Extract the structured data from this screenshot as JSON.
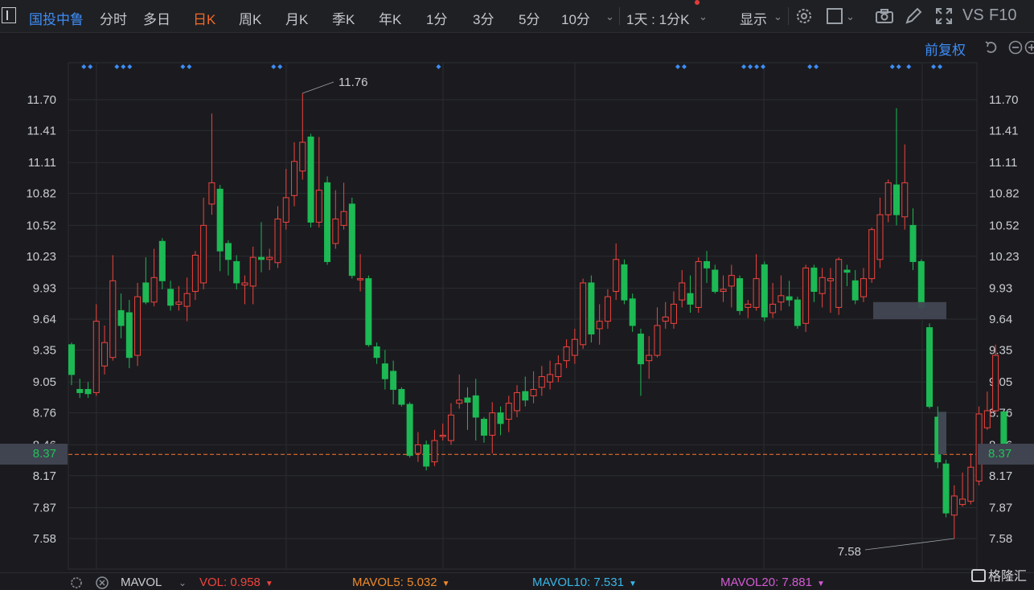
{
  "toolbar": {
    "symbol": "国投中鲁",
    "periods": [
      "分时",
      "多日",
      "日K",
      "周K",
      "月K",
      "季K",
      "年K",
      "1分",
      "3分",
      "5分",
      "10分"
    ],
    "active_period": "日K",
    "multi_period": "1天 : 1分K",
    "display": "显示",
    "vs_label": "VS",
    "f10_label": "F10"
  },
  "adjust_label": "前复权",
  "axis": {
    "price_ticks": [
      "11.70",
      "11.41",
      "11.11",
      "10.82",
      "10.52",
      "10.23",
      "9.93",
      "9.64",
      "9.35",
      "9.05",
      "8.76",
      "8.46",
      "8.17",
      "7.87",
      "7.58"
    ],
    "current_price": "8.37",
    "high_label": "11.76",
    "low_label": "7.58"
  },
  "chart_data": {
    "type": "candlestick",
    "ylim": [
      7.4,
      11.9
    ],
    "current_price": 8.37,
    "high": 11.76,
    "low": 7.58,
    "colors": {
      "up": "#f0433d",
      "down": "#1db954",
      "current_line": "#e46a2c",
      "background": "#1b1b1f",
      "grid": "#2a2c31",
      "marker": "#3d8df6"
    },
    "candles": [
      [
        9.4,
        9.12,
        9.42,
        9.02
      ],
      [
        8.98,
        8.95,
        9.08,
        8.9
      ],
      [
        8.98,
        8.94,
        9.05,
        8.9
      ],
      [
        8.95,
        9.62,
        9.78,
        8.92
      ],
      [
        9.2,
        9.42,
        9.58,
        9.12
      ],
      [
        9.28,
        10.0,
        10.24,
        9.25
      ],
      [
        9.72,
        9.58,
        9.88,
        9.46
      ],
      [
        9.7,
        9.28,
        9.82,
        9.18
      ],
      [
        9.3,
        9.85,
        9.98,
        9.2
      ],
      [
        9.98,
        9.8,
        10.22,
        9.78
      ],
      [
        9.8,
        10.03,
        10.3,
        9.76
      ],
      [
        10.37,
        10.0,
        10.4,
        9.92
      ],
      [
        9.92,
        9.77,
        10.0,
        9.72
      ],
      [
        9.78,
        9.8,
        9.95,
        9.72
      ],
      [
        9.76,
        9.88,
        10.03,
        9.62
      ],
      [
        9.9,
        10.24,
        10.28,
        9.82
      ],
      [
        9.98,
        10.52,
        10.78,
        9.92
      ],
      [
        10.72,
        10.92,
        11.57,
        10.62
      ],
      [
        10.86,
        10.28,
        10.9,
        10.09
      ],
      [
        10.35,
        10.2,
        10.38,
        10.05
      ],
      [
        10.18,
        9.98,
        10.24,
        9.92
      ],
      [
        9.96,
        9.98,
        10.05,
        9.78
      ],
      [
        9.95,
        10.22,
        10.32,
        9.78
      ],
      [
        10.22,
        10.2,
        10.55,
        10.08
      ],
      [
        10.2,
        10.22,
        10.3,
        10.1
      ],
      [
        10.17,
        10.58,
        10.7,
        10.12
      ],
      [
        10.55,
        10.78,
        11.05,
        10.48
      ],
      [
        10.8,
        11.12,
        11.3,
        10.7
      ],
      [
        11.03,
        11.3,
        11.76,
        10.95
      ],
      [
        11.35,
        10.55,
        11.38,
        10.5
      ],
      [
        10.55,
        10.85,
        11.35,
        10.5
      ],
      [
        10.92,
        10.18,
        10.98,
        10.15
      ],
      [
        10.35,
        10.58,
        10.85,
        10.3
      ],
      [
        10.52,
        10.65,
        10.92,
        10.48
      ],
      [
        10.72,
        10.05,
        10.78,
        10.02
      ],
      [
        10.02,
        10.02,
        10.25,
        9.9
      ],
      [
        10.02,
        9.4,
        10.05,
        9.38
      ],
      [
        9.38,
        9.28,
        9.42,
        9.22
      ],
      [
        9.22,
        9.08,
        9.35,
        8.98
      ],
      [
        9.15,
        8.98,
        9.25,
        8.84
      ],
      [
        8.98,
        8.84,
        9.0,
        8.82
      ],
      [
        8.84,
        8.36,
        8.86,
        8.34
      ],
      [
        8.38,
        8.46,
        8.58,
        8.3
      ],
      [
        8.46,
        8.26,
        8.5,
        8.22
      ],
      [
        8.3,
        8.5,
        8.6,
        8.26
      ],
      [
        8.54,
        8.55,
        8.66,
        8.5
      ],
      [
        8.5,
        8.74,
        8.85,
        8.46
      ],
      [
        8.85,
        8.88,
        9.12,
        8.8
      ],
      [
        8.9,
        8.86,
        9.0,
        8.6
      ],
      [
        8.92,
        8.72,
        9.08,
        8.5
      ],
      [
        8.7,
        8.55,
        8.72,
        8.48
      ],
      [
        8.55,
        8.76,
        8.86,
        8.38
      ],
      [
        8.76,
        8.66,
        8.82,
        8.55
      ],
      [
        8.7,
        8.85,
        8.92,
        8.58
      ],
      [
        8.78,
        8.95,
        9.02,
        8.72
      ],
      [
        8.96,
        8.88,
        9.1,
        8.82
      ],
      [
        8.92,
        8.98,
        9.15,
        8.85
      ],
      [
        9.0,
        9.1,
        9.2,
        8.92
      ],
      [
        9.05,
        9.12,
        9.25,
        8.98
      ],
      [
        9.1,
        9.22,
        9.3,
        9.05
      ],
      [
        9.25,
        9.38,
        9.45,
        9.18
      ],
      [
        9.3,
        9.45,
        9.55,
        9.22
      ],
      [
        9.4,
        9.98,
        10.02,
        9.36
      ],
      [
        9.98,
        9.5,
        10.05,
        9.42
      ],
      [
        9.55,
        9.62,
        9.78,
        9.4
      ],
      [
        9.62,
        9.85,
        9.92,
        9.55
      ],
      [
        9.9,
        10.2,
        10.35,
        9.82
      ],
      [
        10.15,
        9.82,
        10.2,
        9.78
      ],
      [
        9.83,
        9.58,
        9.88,
        9.52
      ],
      [
        9.5,
        9.22,
        9.55,
        8.92
      ],
      [
        9.25,
        9.3,
        9.48,
        9.08
      ],
      [
        9.3,
        9.58,
        9.75,
        9.28
      ],
      [
        9.62,
        9.66,
        9.8,
        9.55
      ],
      [
        9.6,
        9.78,
        9.9,
        9.55
      ],
      [
        9.82,
        9.98,
        10.1,
        9.75
      ],
      [
        9.88,
        9.78,
        10.05,
        9.7
      ],
      [
        9.75,
        10.18,
        10.22,
        9.7
      ],
      [
        10.18,
        10.12,
        10.28,
        9.98
      ],
      [
        10.1,
        9.9,
        10.15,
        9.88
      ],
      [
        9.9,
        9.92,
        10.05,
        9.8
      ],
      [
        9.95,
        10.05,
        10.15,
        9.75
      ],
      [
        10.02,
        9.72,
        10.05,
        9.68
      ],
      [
        9.75,
        9.78,
        9.82,
        9.65
      ],
      [
        9.75,
        10.02,
        10.25,
        9.72
      ],
      [
        10.15,
        9.66,
        10.18,
        9.62
      ],
      [
        9.7,
        9.78,
        9.98,
        9.65
      ],
      [
        9.8,
        9.86,
        10.05,
        9.72
      ],
      [
        9.85,
        9.82,
        10.0,
        9.76
      ],
      [
        9.82,
        9.58,
        9.85,
        9.55
      ],
      [
        9.6,
        10.12,
        10.15,
        9.52
      ],
      [
        10.12,
        9.9,
        10.15,
        9.8
      ],
      [
        9.88,
        10.03,
        10.12,
        9.75
      ],
      [
        10.0,
        10.02,
        10.12,
        9.7
      ],
      [
        9.75,
        10.2,
        10.22,
        9.68
      ],
      [
        10.1,
        10.08,
        10.15,
        9.95
      ],
      [
        10.0,
        9.82,
        10.1,
        9.78
      ],
      [
        9.85,
        10.02,
        10.12,
        9.8
      ],
      [
        10.02,
        10.48,
        10.5,
        9.98
      ],
      [
        10.2,
        10.62,
        10.78,
        10.12
      ],
      [
        10.62,
        10.92,
        10.95,
        10.55
      ],
      [
        10.9,
        10.62,
        11.62,
        10.52
      ],
      [
        10.6,
        10.92,
        11.28,
        10.48
      ],
      [
        10.52,
        10.18,
        10.68,
        10.1
      ],
      [
        10.18,
        9.75,
        10.2,
        9.72
      ],
      [
        9.56,
        8.82,
        9.6,
        8.8
      ],
      [
        8.72,
        8.3,
        8.82,
        8.24
      ],
      [
        8.28,
        7.82,
        8.32,
        7.78
      ],
      [
        7.8,
        7.98,
        8.08,
        7.58
      ],
      [
        7.9,
        7.95,
        8.2,
        7.88
      ],
      [
        7.93,
        8.25,
        8.38,
        7.9
      ],
      [
        8.12,
        8.75,
        8.82,
        8.08
      ],
      [
        8.62,
        8.78,
        8.96,
        8.6
      ],
      [
        8.78,
        9.3,
        9.4,
        8.75
      ],
      [
        8.77,
        8.37,
        8.77,
        8.37
      ]
    ]
  },
  "markers": [
    {
      "candle": 1,
      "count": 2
    },
    {
      "candle": 5,
      "count": 3
    },
    {
      "candle": 13,
      "count": 2
    },
    {
      "candle": 24,
      "count": 2
    },
    {
      "candle": 44,
      "count": 1
    },
    {
      "candle": 73,
      "count": 2
    },
    {
      "candle": 81,
      "count": 4
    },
    {
      "candle": 89,
      "count": 2
    },
    {
      "candle": 99,
      "count": 2
    },
    {
      "candle": 101,
      "count": 1
    },
    {
      "candle": 104,
      "count": 2
    }
  ],
  "footer": {
    "indicator": "MAVOL",
    "vol": "VOL: 0.958",
    "mavol5": "MAVOL5: 5.032",
    "mavol10": "MAVOL10: 7.531",
    "mavol20": "MAVOL20: 7.881",
    "vol_color": "#f0433d",
    "mavol5_color": "#f08a2a",
    "mavol10_color": "#38b6e8",
    "mavol20_color": "#d45ad4"
  },
  "watermark": "格隆汇"
}
